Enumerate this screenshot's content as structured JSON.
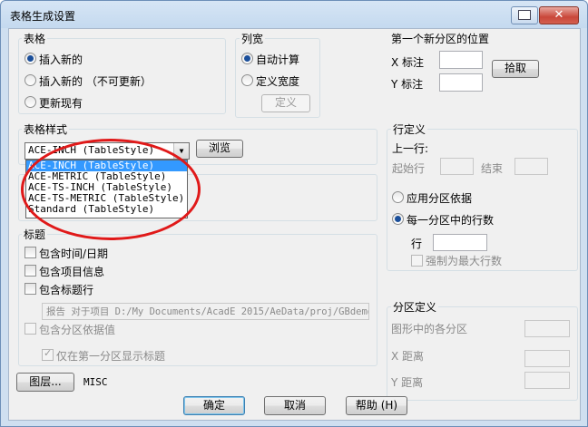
{
  "window": {
    "title": "表格生成设置",
    "close_glyph": "✕"
  },
  "table_group": {
    "title": "表格",
    "options": [
      "插入新的",
      "插入新的 （不可更新）",
      "更新现有"
    ],
    "selected": 0
  },
  "columns_group": {
    "title": "列宽",
    "options": [
      "自动计算",
      "定义宽度"
    ],
    "selected": 0,
    "define_button": "定义"
  },
  "first_partition": {
    "title": "第一个新分区的位置",
    "x_label": "X 标注",
    "y_label": "Y 标注",
    "pick_button": "拾取"
  },
  "style_group": {
    "title": "表格样式",
    "selected_value": "ACE-INCH  (TableStyle)",
    "browse_button": "浏览",
    "dropdown_items": [
      "ACE-INCH  (TableStyle)",
      "ACE-METRIC  (TableStyle)",
      "ACE-TS-INCH  (TableStyle)",
      "ACE-TS-METRIC  (TableStyle)",
      "Standard  (TableStyle)"
    ],
    "dropdown_selected": 0
  },
  "row_def": {
    "title": "行定义",
    "upper_row": "上一行:",
    "start_row": "起始行",
    "end_row": "结束",
    "options": [
      "应用分区依据",
      "每一分区中的行数"
    ],
    "selected": 1,
    "row_label": "行",
    "force_max_label": "强制为最大行数"
  },
  "heading_group": {
    "title": "标题",
    "checks": [
      "包含时间/日期",
      "包含项目信息",
      "包含标题行"
    ],
    "report_text": "报告 对于项目 D:/My Documents/AcadE 2015/AeData/proj/GBdemo",
    "include_partition": "包含分区依据值",
    "first_partition_only": "仅在第一分区显示标题"
  },
  "partition_def": {
    "title": "分区定义",
    "in_figure": "图形中的各分区",
    "x_distance": "X 距离",
    "y_distance": "Y 距离"
  },
  "layer": {
    "button": "图层...",
    "value": "MISC"
  },
  "footer": {
    "ok": "确定",
    "cancel": "取消",
    "help": "帮助 (H)"
  },
  "colors": {
    "annotation_ellipse": "#e01919",
    "selection": "#3399ff"
  }
}
